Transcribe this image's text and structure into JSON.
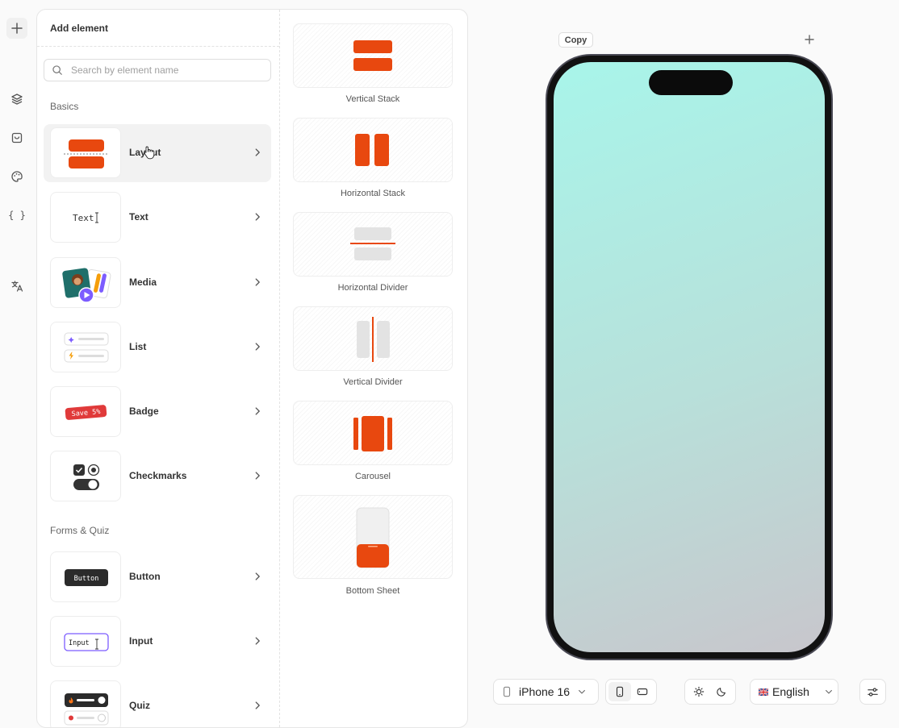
{
  "panel": {
    "title": "Add element",
    "search_placeholder": "Search by element name",
    "sections": {
      "basics": "Basics",
      "forms": "Forms & Quiz"
    },
    "elements": [
      {
        "label": "Layout"
      },
      {
        "label": "Text",
        "thumb_text": "Text"
      },
      {
        "label": "Media"
      },
      {
        "label": "List"
      },
      {
        "label": "Badge",
        "thumb_text": "Save 5%"
      },
      {
        "label": "Checkmarks"
      },
      {
        "label": "Button",
        "thumb_text": "Button"
      },
      {
        "label": "Input",
        "thumb_text": "Input"
      },
      {
        "label": "Quiz"
      }
    ],
    "layouts": [
      {
        "label": "Vertical Stack"
      },
      {
        "label": "Horizontal Stack"
      },
      {
        "label": "Horizontal Divider"
      },
      {
        "label": "Vertical Divider"
      },
      {
        "label": "Carousel"
      },
      {
        "label": "Bottom Sheet"
      }
    ]
  },
  "preview": {
    "copy_label": "Copy",
    "device": "iPhone 16",
    "language": "English"
  },
  "colors": {
    "accent": "#e8480f",
    "screen_top": "#a8f5ea",
    "screen_bottom": "#c8c6cc"
  }
}
